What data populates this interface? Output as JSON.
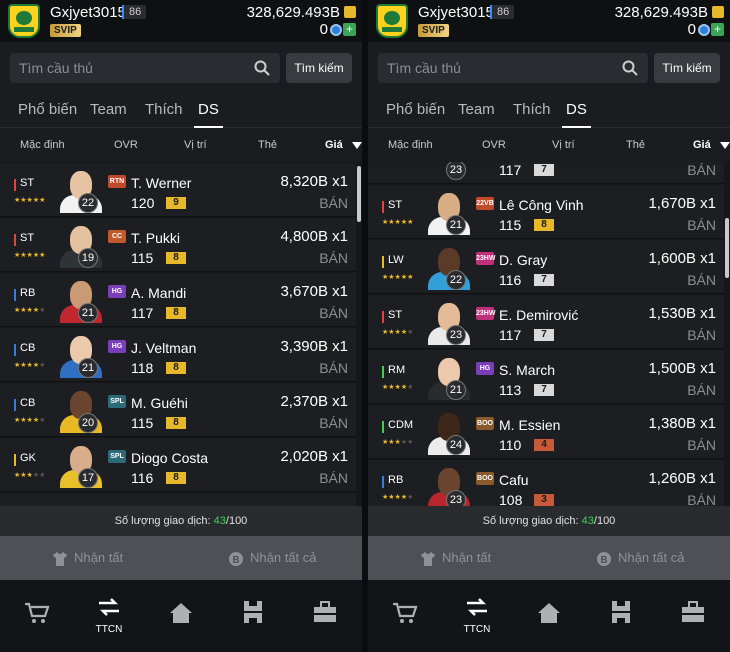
{
  "user": {
    "name": "Gxjyet3015",
    "level": "86",
    "vip": "SVIP",
    "balance": "328,629.493B",
    "coins": "0"
  },
  "search": {
    "placeholder": "Tìm cầu thủ",
    "button": "Tìm kiếm"
  },
  "tabs": [
    "Phổ biến",
    "Team",
    "Thích",
    "DS"
  ],
  "sort_headers": [
    "Mặc định",
    "OVR",
    "Vị trí",
    "Thẻ",
    "Giá"
  ],
  "transactions": {
    "label": "Số lượng giao dịch: ",
    "count": "43",
    "max": "/100"
  },
  "claim": {
    "left": "Nhận tất",
    "right": "Nhận tất cả"
  },
  "nav": {
    "active_label": "TTCN"
  },
  "left_list": [
    {
      "pos": "ST",
      "pos_color": "#e0473a",
      "stars": 5,
      "card": "RTN",
      "card_color": "#c04a2a",
      "name": "T. Werner",
      "ovr_circle": "22",
      "ovr": "120",
      "grade": "9",
      "grade_color": "#e7b72c",
      "price": "8,320B x1",
      "sell": "BÁN",
      "skin": "#e8c3a3",
      "shirt": "#f2f2f2"
    },
    {
      "pos": "ST",
      "pos_color": "#e0473a",
      "stars": 5,
      "card": "CC",
      "card_color": "#c05a2c",
      "name": "T. Pukki",
      "ovr_circle": "19",
      "ovr": "115",
      "grade": "8",
      "grade_color": "#e7b72c",
      "price": "4,800B x1",
      "sell": "BÁN",
      "skin": "#e6c1a0",
      "shirt": "#2e3338"
    },
    {
      "pos": "RB",
      "pos_color": "#3a7be0",
      "stars": 4,
      "card": "HG",
      "card_color": "#7a3fb8",
      "name": "A. Mandi",
      "ovr_circle": "21",
      "ovr": "117",
      "grade": "8",
      "grade_color": "#e7b72c",
      "price": "3,670B x1",
      "sell": "BÁN",
      "skin": "#c99a74",
      "shirt": "#c2262e"
    },
    {
      "pos": "CB",
      "pos_color": "#3a7be0",
      "stars": 4,
      "card": "HG",
      "card_color": "#7a3fb8",
      "name": "J. Veltman",
      "ovr_circle": "21",
      "ovr": "118",
      "grade": "8",
      "grade_color": "#e7b72c",
      "price": "3,390B x1",
      "sell": "BÁN",
      "skin": "#ecc9aa",
      "shirt": "#2f6fc4"
    },
    {
      "pos": "CB",
      "pos_color": "#3a7be0",
      "stars": 4,
      "card": "SPL",
      "card_color": "#2c6a7a",
      "name": "M. Guéhi",
      "ovr_circle": "20",
      "ovr": "115",
      "grade": "8",
      "grade_color": "#e7b72c",
      "price": "2,370B x1",
      "sell": "BÁN",
      "skin": "#6b4530",
      "shirt": "#e8b923"
    },
    {
      "pos": "GK",
      "pos_color": "#e7b72c",
      "stars": 3,
      "card": "SPL",
      "card_color": "#2c6a7a",
      "name": "Diogo Costa",
      "ovr_circle": "17",
      "ovr": "116",
      "grade": "8",
      "grade_color": "#e7b72c",
      "price": "2,020B x1",
      "sell": "BÁN",
      "skin": "#d8ae8a",
      "shirt": "#e8c12a"
    }
  ],
  "right_top_partial": {
    "ovr_circle": "23",
    "ovr": "117",
    "grade": "7",
    "price": "BÁN"
  },
  "right_list": [
    {
      "pos": "ST",
      "pos_color": "#e0473a",
      "stars": 5,
      "card": "22VB",
      "card_color": "#c04a2a",
      "name": "Lê Công Vinh",
      "ovr_circle": "21",
      "ovr": "115",
      "grade": "8",
      "grade_color": "#e7b72c",
      "price": "1,670B x1",
      "sell": "BÁN",
      "skin": "#d9ad84",
      "shirt": "#f2f2f2"
    },
    {
      "pos": "LW",
      "pos_color": "#e7b72c",
      "stars": 5,
      "card": "23HW",
      "card_color": "#c0307a",
      "name": "D. Gray",
      "ovr_circle": "22",
      "ovr": "116",
      "grade": "7",
      "grade_color": "#d9d9d9",
      "price": "1,600B x1",
      "sell": "BÁN",
      "skin": "#5b3a28",
      "shirt": "#2fa0d8"
    },
    {
      "pos": "ST",
      "pos_color": "#e0473a",
      "stars": 4,
      "card": "23HW",
      "card_color": "#c0307a",
      "name": "E. Demirović",
      "ovr_circle": "23",
      "ovr": "117",
      "grade": "7",
      "grade_color": "#d9d9d9",
      "price": "1,530B x1",
      "sell": "BÁN",
      "skin": "#e3bb96",
      "shirt": "#e9e9e9"
    },
    {
      "pos": "RM",
      "pos_color": "#3ecf5a",
      "stars": 4,
      "card": "HG",
      "card_color": "#7a3fb8",
      "name": "S. March",
      "ovr_circle": "21",
      "ovr": "113",
      "grade": "7",
      "grade_color": "#d9d9d9",
      "price": "1,500B x1",
      "sell": "BÁN",
      "skin": "#ecc9aa",
      "shirt": "#2a2b2f"
    },
    {
      "pos": "CDM",
      "pos_color": "#3ecf5a",
      "stars": 3,
      "card": "BOO",
      "card_color": "#8a5a2a",
      "name": "M. Essien",
      "ovr_circle": "24",
      "ovr": "110",
      "grade": "4",
      "grade_color": "#c85a3a",
      "price": "1,380B x1",
      "sell": "BÁN",
      "skin": "#3d271b",
      "shirt": "#ececec"
    },
    {
      "pos": "RB",
      "pos_color": "#3a7be0",
      "stars": 4,
      "card": "BOO",
      "card_color": "#8a5a2a",
      "name": "Cafu",
      "ovr_circle": "23",
      "ovr": "108",
      "grade": "3",
      "grade_color": "#c85a3a",
      "price": "1,260B x1",
      "sell": "BÁN",
      "skin": "#6b4530",
      "shirt": "#b8252c"
    }
  ]
}
